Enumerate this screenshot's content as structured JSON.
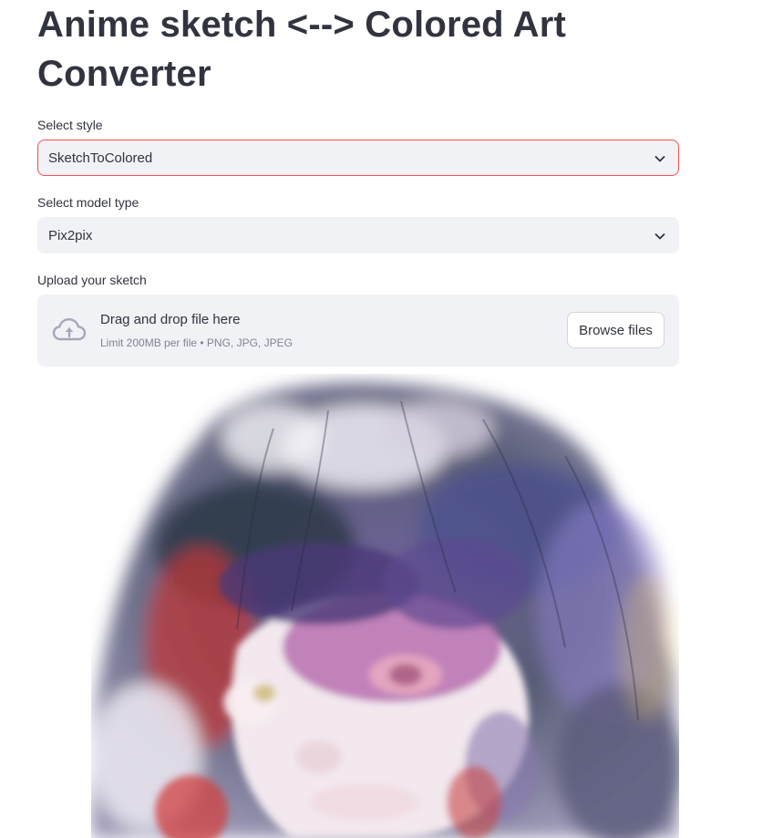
{
  "page": {
    "title": "Anime sketch <--> Colored Art Converter"
  },
  "style_select": {
    "label": "Select style",
    "value": "SketchToColored"
  },
  "model_select": {
    "label": "Select model type",
    "value": "Pix2pix"
  },
  "uploader": {
    "label": "Upload your sketch",
    "drop_text": "Drag and drop file here",
    "limit_text": "Limit 200MB per file • PNG, JPG, JPEG",
    "browse_label": "Browse files",
    "icon": "cloud-upload-icon"
  },
  "colors": {
    "accent": "#ff4b4b",
    "widget_bg": "#f0f2f6",
    "text": "#31333f",
    "muted": "#808495"
  }
}
